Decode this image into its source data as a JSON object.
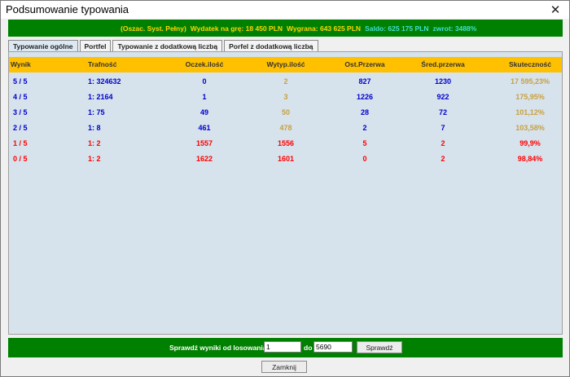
{
  "window": {
    "title": "Podsumowanie typowania",
    "close_glyph": "✕"
  },
  "summary": [
    {
      "text": "(Oszac. Syst. Pełny)",
      "color": "#ffd700"
    },
    {
      "text": "Wydatek na grę: 18 450 PLN",
      "color": "#ffd700"
    },
    {
      "text": "Wygrana: 643 625 PLN",
      "color": "#ffd700"
    },
    {
      "text": "Saldo: 625 175 PLN",
      "color": "#40e0d0"
    },
    {
      "text": "zwrot: 3488%",
      "color": "#40e0d0"
    }
  ],
  "tabs": [
    {
      "label": "Typowanie ogólne",
      "active": true
    },
    {
      "label": "Portfel",
      "active": false
    },
    {
      "label": "Typowanie z dodatkową liczbą",
      "active": false
    },
    {
      "label": "Porfel z dodatkową liczbą",
      "active": false
    }
  ],
  "table": {
    "headers": [
      "Wynik",
      "Trafność",
      "Oczek.ilość",
      "Wytyp.ilość",
      "Ost.Przerwa",
      "Śred.przerwa",
      "Skuteczność"
    ],
    "rows": [
      {
        "cells": [
          "5 / 5",
          "1: 324632",
          "0",
          "2",
          "827",
          "1230",
          "17 595,23%"
        ],
        "color": "#0000cc",
        "accent": "#c8a040"
      },
      {
        "cells": [
          "4 / 5",
          "1: 2164",
          "1",
          "3",
          "1226",
          "922",
          "175,95%"
        ],
        "color": "#0000cc",
        "accent": "#c8a040"
      },
      {
        "cells": [
          "3 / 5",
          "1: 75",
          "49",
          "50",
          "28",
          "72",
          "101,12%"
        ],
        "color": "#0000cc",
        "accent": "#c8a040"
      },
      {
        "cells": [
          "2 / 5",
          "1: 8",
          "461",
          "478",
          "2",
          "7",
          "103,58%"
        ],
        "color": "#0000cc",
        "accent": "#c8a040"
      },
      {
        "cells": [
          "1 / 5",
          "1: 2",
          "1557",
          "1556",
          "5",
          "2",
          "99,9%"
        ],
        "color": "#ff0000",
        "accent": "#ff0000"
      },
      {
        "cells": [
          "0 / 5",
          "1: 2",
          "1622",
          "1601",
          "0",
          "2",
          "98,84%"
        ],
        "color": "#ff0000",
        "accent": "#ff0000"
      }
    ]
  },
  "bottom": {
    "check_label": "Sprawdź wyniki od losowania:",
    "from_value": "1",
    "to_label": "do",
    "to_value": "5690",
    "check_button": "Sprawdź"
  },
  "close_button": "Zamknij"
}
